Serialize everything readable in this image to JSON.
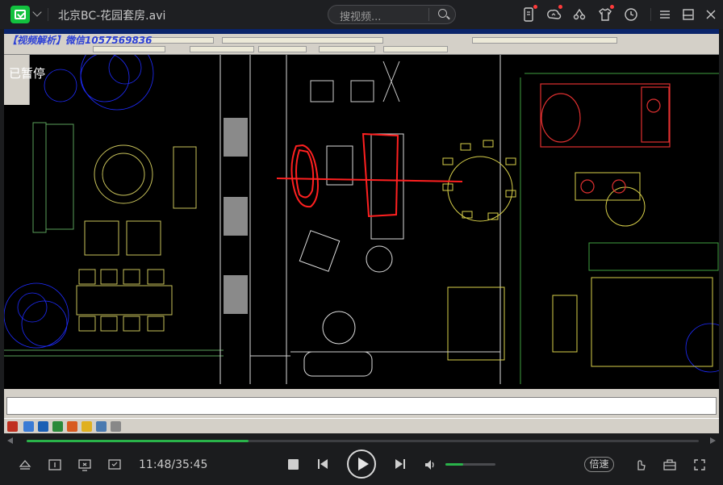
{
  "app": {
    "title": "北京BC-花园套房.avi",
    "search_placeholder": "搜视频...",
    "top_icons": [
      "phone-icon",
      "cloud-sync-icon",
      "share-icon",
      "tshirt-skin-icon",
      "history-clock-icon"
    ],
    "window_controls": [
      "menu-icon",
      "minimize-icon",
      "maximize-icon",
      "close-icon"
    ],
    "accent_color": "#2ab34a"
  },
  "video": {
    "watermark": "【视频解析】微信1057569836",
    "status_text": "已暂停"
  },
  "controls": {
    "current_time": "11:48",
    "total_time": "35:45",
    "time_display": "11:48/35:45",
    "progress_fraction": 0.33,
    "volume_fraction": 0.35,
    "speed_label": "倍速"
  }
}
